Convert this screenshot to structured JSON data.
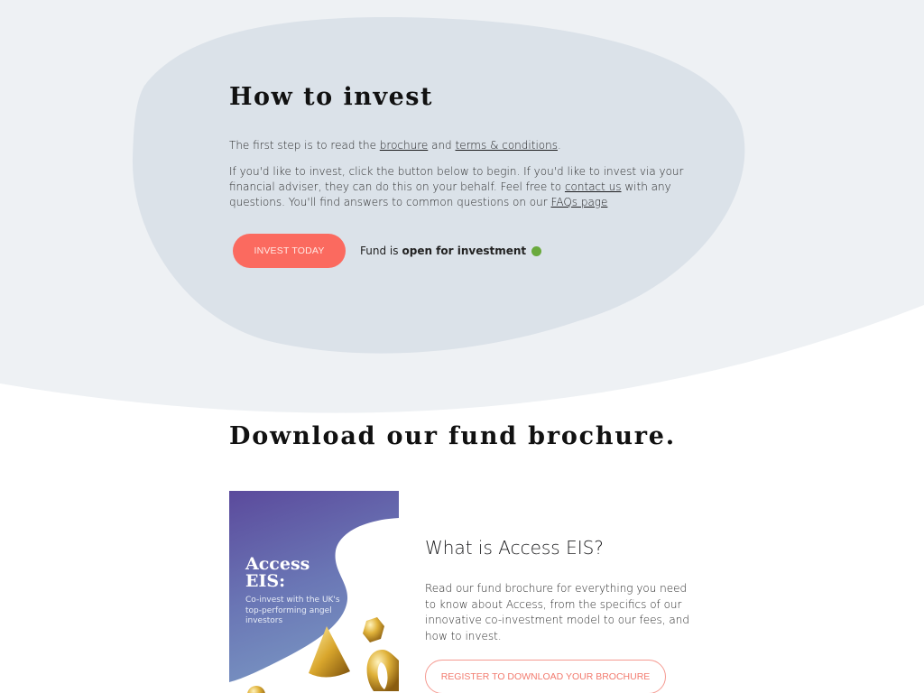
{
  "colors": {
    "page_background": "#ffffff",
    "top_band": "#eef1f4",
    "blob": "#dbe2e9",
    "accent": "#fb6a5f",
    "status_open": "#6aaa3d"
  },
  "invest": {
    "title": "How to invest",
    "p1": {
      "before": "The first step is to read the ",
      "brochure_link": "brochure",
      "middle": " and ",
      "terms_link": "terms & conditions",
      "end": "."
    },
    "p2": {
      "before": "If you'd like to invest, click the button below to begin. If you'd like to invest via your financial adviser, they can do this on your behalf. Feel free to ",
      "contact_link": "contact us",
      "middle": " with any questions. You'll find answers to common questions on our ",
      "faq_link": "FAQs page"
    },
    "button_label": "INVEST TODAY",
    "status_prefix": "Fund is",
    "status_value": "open for investment",
    "status_icon": "green-dot-icon"
  },
  "download": {
    "title": "Download our fund brochure.",
    "cover": {
      "title_line1": "Access",
      "title_line2": "EIS:",
      "subtitle": "Co-invest with the UK's top-performing angel investors"
    },
    "heading": "What is Access EIS?",
    "text": "Read our fund brochure for everything you need to know about Access, from the specifics of our innovative co-investment model to our fees, and how to invest.",
    "button_label": "REGISTER TO DOWNLOAD YOUR BROCHURE"
  }
}
